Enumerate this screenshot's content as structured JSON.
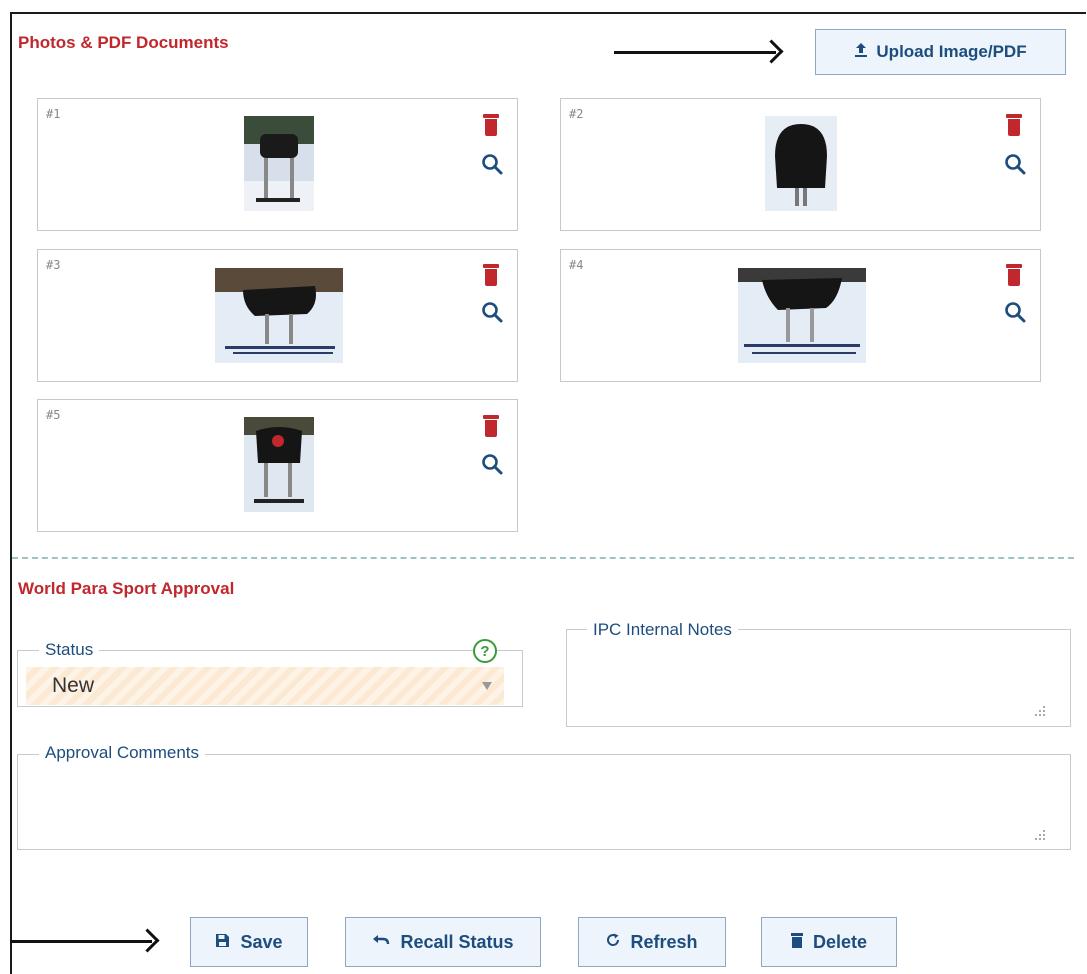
{
  "photos": {
    "title": "Photos & PDF Documents",
    "upload_label": "Upload Image/PDF",
    "items": [
      {
        "number": "#1"
      },
      {
        "number": "#2"
      },
      {
        "number": "#3"
      },
      {
        "number": "#4"
      },
      {
        "number": "#5"
      }
    ]
  },
  "approval": {
    "title": "World Para Sport Approval",
    "status_label": "Status",
    "status_value": "New",
    "help_glyph": "?",
    "internal_notes_label": "IPC Internal Notes",
    "comments_label": "Approval Comments"
  },
  "actions": {
    "save": "Save",
    "recall": "Recall Status",
    "refresh": "Refresh",
    "delete": "Delete"
  },
  "icons": {
    "upload": "upload-icon",
    "trash": "trash-icon",
    "zoom": "magnifier-icon",
    "help": "question-circle-icon",
    "save": "floppy-disk-icon",
    "recall": "undo-icon",
    "refresh": "refresh-icon",
    "delete": "trash-icon"
  },
  "colors": {
    "accent_red": "#c0282d",
    "link_blue": "#1d4d7e",
    "button_bg": "#eef4fb",
    "help_green": "#3a9a3a"
  }
}
